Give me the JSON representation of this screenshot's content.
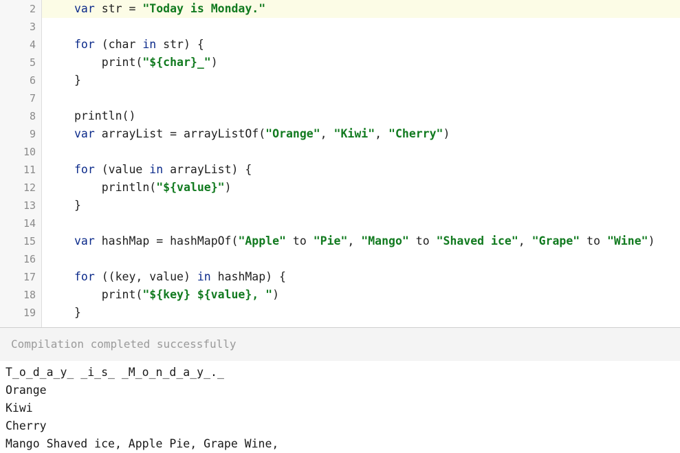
{
  "editor": {
    "line_numbers": [
      "2",
      "3",
      "4",
      "5",
      "6",
      "7",
      "8",
      "9",
      "10",
      "11",
      "12",
      "13",
      "14",
      "15",
      "16",
      "17",
      "18",
      "19"
    ],
    "lines": [
      [
        {
          "t": "kw",
          "v": "var"
        },
        {
          "t": "plain",
          "v": " str = "
        },
        {
          "t": "str",
          "v": "\"Today is Monday.\""
        }
      ],
      [],
      [
        {
          "t": "kw",
          "v": "for"
        },
        {
          "t": "plain",
          "v": " (char "
        },
        {
          "t": "kw",
          "v": "in"
        },
        {
          "t": "plain",
          "v": " str) {"
        }
      ],
      [
        {
          "t": "plain",
          "v": "    print("
        },
        {
          "t": "str",
          "v": "\"${char}_\""
        },
        {
          "t": "plain",
          "v": ")"
        }
      ],
      [
        {
          "t": "plain",
          "v": "}"
        }
      ],
      [],
      [
        {
          "t": "plain",
          "v": "println()"
        }
      ],
      [
        {
          "t": "kw",
          "v": "var"
        },
        {
          "t": "plain",
          "v": " arrayList = arrayListOf("
        },
        {
          "t": "str",
          "v": "\"Orange\""
        },
        {
          "t": "plain",
          "v": ", "
        },
        {
          "t": "str",
          "v": "\"Kiwi\""
        },
        {
          "t": "plain",
          "v": ", "
        },
        {
          "t": "str",
          "v": "\"Cherry\""
        },
        {
          "t": "plain",
          "v": ")"
        }
      ],
      [],
      [
        {
          "t": "kw",
          "v": "for"
        },
        {
          "t": "plain",
          "v": " (value "
        },
        {
          "t": "kw",
          "v": "in"
        },
        {
          "t": "plain",
          "v": " arrayList) {"
        }
      ],
      [
        {
          "t": "plain",
          "v": "    println("
        },
        {
          "t": "str",
          "v": "\"${value}\""
        },
        {
          "t": "plain",
          "v": ")"
        }
      ],
      [
        {
          "t": "plain",
          "v": "}"
        }
      ],
      [],
      [
        {
          "t": "kw",
          "v": "var"
        },
        {
          "t": "plain",
          "v": " hashMap = hashMapOf("
        },
        {
          "t": "str",
          "v": "\"Apple\""
        },
        {
          "t": "plain",
          "v": " to "
        },
        {
          "t": "str",
          "v": "\"Pie\""
        },
        {
          "t": "plain",
          "v": ", "
        },
        {
          "t": "str",
          "v": "\"Mango\""
        },
        {
          "t": "plain",
          "v": " to "
        },
        {
          "t": "str",
          "v": "\"Shaved ice\""
        },
        {
          "t": "plain",
          "v": ", "
        },
        {
          "t": "str",
          "v": "\"Grape\""
        },
        {
          "t": "plain",
          "v": " to "
        },
        {
          "t": "str",
          "v": "\"Wine\""
        },
        {
          "t": "plain",
          "v": ")"
        }
      ],
      [],
      [
        {
          "t": "kw",
          "v": "for"
        },
        {
          "t": "plain",
          "v": " ((key, value) "
        },
        {
          "t": "kw",
          "v": "in"
        },
        {
          "t": "plain",
          "v": " hashMap) {"
        }
      ],
      [
        {
          "t": "plain",
          "v": "    print("
        },
        {
          "t": "str",
          "v": "\"${key} ${value}, \""
        },
        {
          "t": "plain",
          "v": ")"
        }
      ],
      [
        {
          "t": "plain",
          "v": "}"
        }
      ]
    ]
  },
  "status": {
    "text": "Compilation completed successfully"
  },
  "output": {
    "lines": [
      "T_o_d_a_y_ _i_s_ _M_o_n_d_a_y_._",
      "Orange",
      "Kiwi",
      "Cherry",
      "Mango Shaved ice, Apple Pie, Grape Wine,"
    ]
  },
  "colors": {
    "keyword": "#0b2a8a",
    "string": "#117a1f",
    "active_line": "#fcfce6"
  }
}
